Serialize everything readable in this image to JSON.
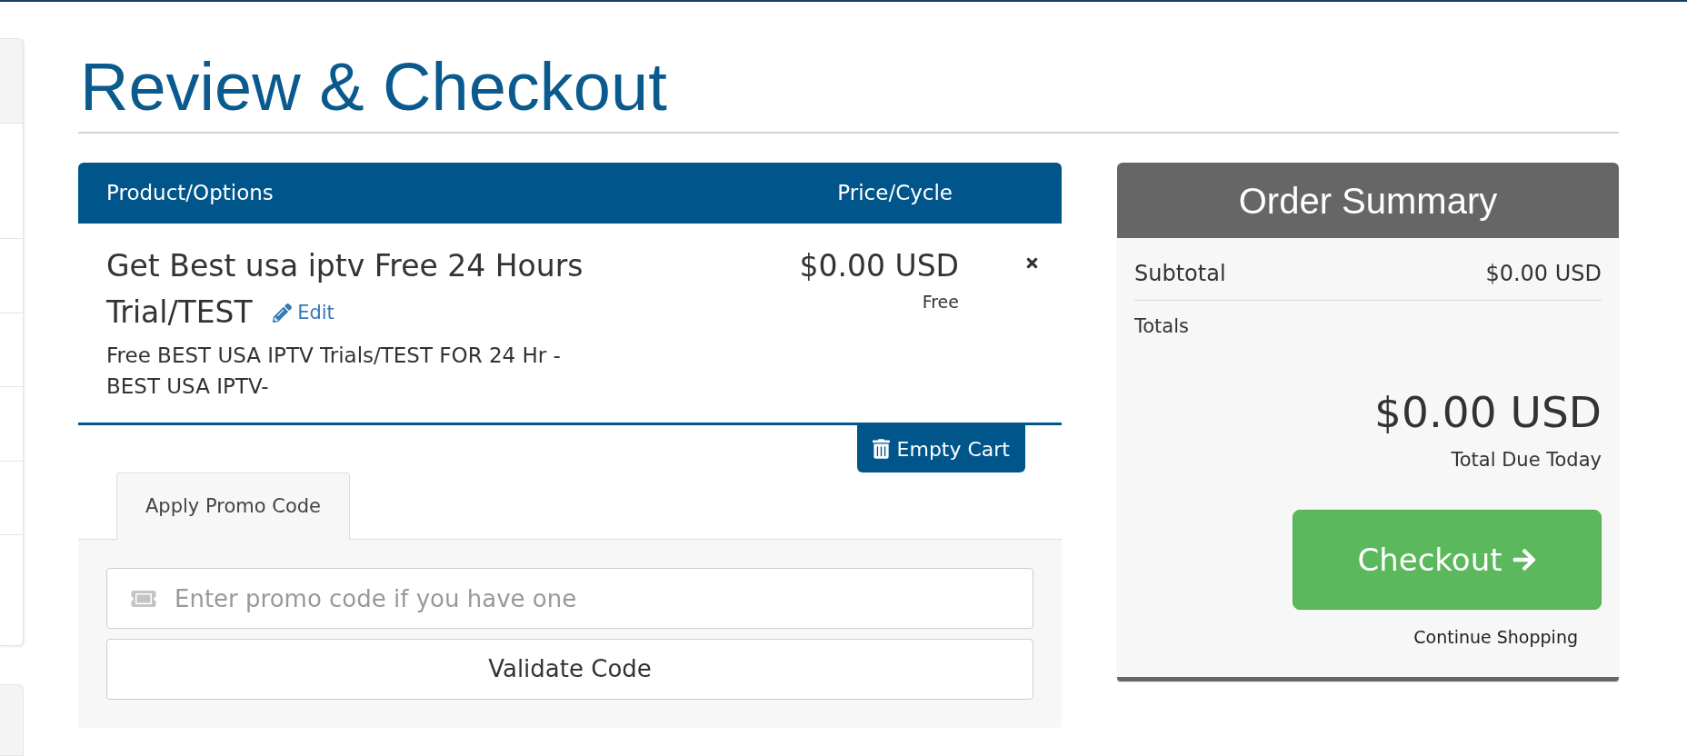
{
  "page": {
    "title": "Review & Checkout"
  },
  "cart": {
    "columns": [
      "Product/Options",
      "Price/Cycle"
    ],
    "items": [
      {
        "name": "Get Best usa iptv Free 24 Hours Trial/TEST",
        "edit_link": "Edit",
        "description": "Free BEST USA IPTV Trials/TEST FOR 24 Hr - BEST USA IPTV-",
        "price": "$0.00 USD",
        "cycle": "Free"
      }
    ],
    "empty_cart_button": "Empty Cart"
  },
  "promo": {
    "tabs": [
      {
        "label": "Apply Promo Code",
        "selected": true
      }
    ],
    "input": {
      "placeholder": "Enter promo code if you have one"
    },
    "validate_button": "Validate Code"
  },
  "order_summary": {
    "title": "Order Summary",
    "subtotal": {
      "label": "Subtotal",
      "value": "$0.00 USD"
    },
    "totals_label": "Totals",
    "total": {
      "value": "$0.00 USD",
      "label": "Total Due Today"
    },
    "checkout_button": "Checkout",
    "continue_link": "Continue Shopping"
  }
}
